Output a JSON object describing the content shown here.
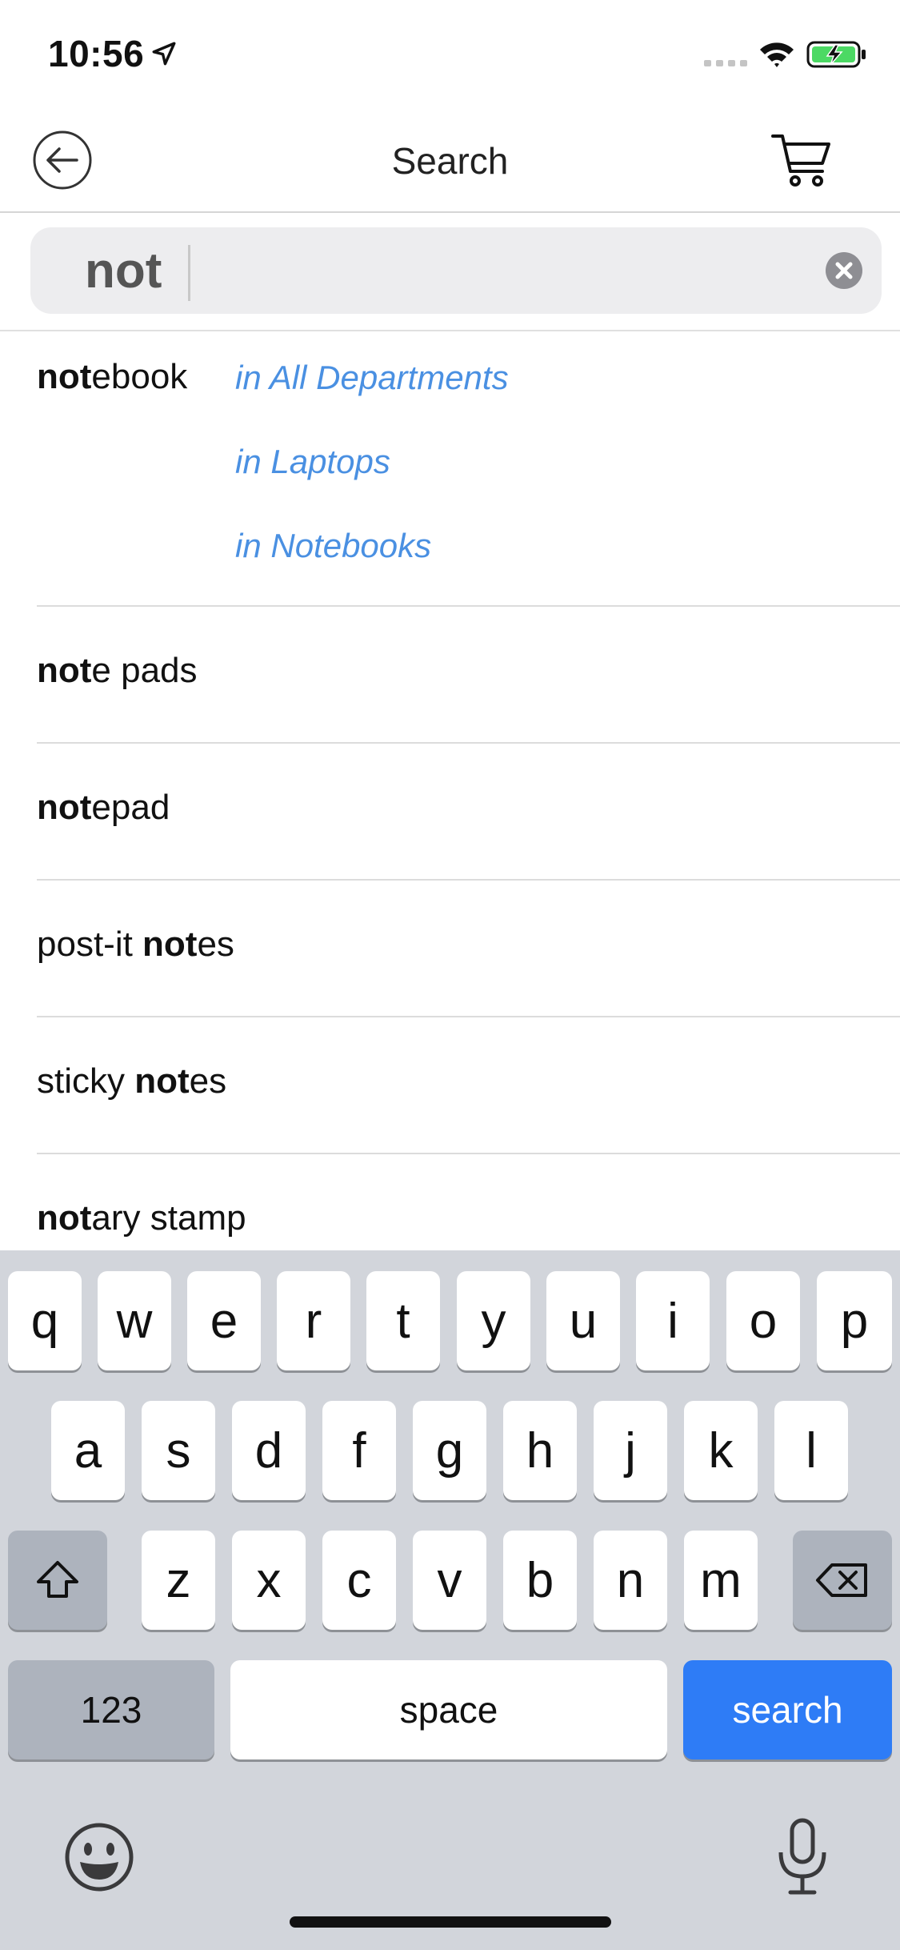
{
  "status": {
    "time": "10:56"
  },
  "nav": {
    "title": "Search",
    "back_icon": "back-arrow-icon",
    "cart_icon": "cart-icon"
  },
  "search": {
    "value": "not",
    "placeholder": ""
  },
  "suggestions": {
    "first": {
      "prefix": "not",
      "suffix": "ebook",
      "departments": [
        "in All Departments",
        "in Laptops",
        "in Notebooks"
      ]
    },
    "items": [
      {
        "pre": "",
        "bold": "not",
        "post": "e pads"
      },
      {
        "pre": "",
        "bold": "not",
        "post": "epad"
      },
      {
        "pre": "post-it ",
        "bold": "not",
        "post": "es"
      },
      {
        "pre": "sticky ",
        "bold": "not",
        "post": "es"
      },
      {
        "pre": "",
        "bold": "not",
        "post": "ary stamp"
      }
    ]
  },
  "keyboard": {
    "row1": [
      "q",
      "w",
      "e",
      "r",
      "t",
      "y",
      "u",
      "i",
      "o",
      "p"
    ],
    "row2": [
      "a",
      "s",
      "d",
      "f",
      "g",
      "h",
      "j",
      "k",
      "l"
    ],
    "row3": [
      "z",
      "x",
      "c",
      "v",
      "b",
      "n",
      "m"
    ],
    "numbers_label": "123",
    "space_label": "space",
    "search_label": "search"
  },
  "colors": {
    "accent_blue": "#2e7cf6",
    "link_blue": "#4a90e2",
    "keyboard_bg": "#d2d5db"
  }
}
